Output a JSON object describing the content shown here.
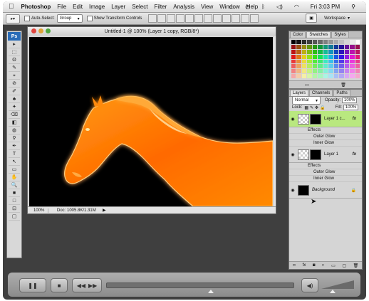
{
  "menubar": {
    "apple": "",
    "app_name": "Photoshop",
    "items": [
      "File",
      "Edit",
      "Image",
      "Layer",
      "Select",
      "Filter",
      "Analysis",
      "View",
      "Window",
      "Help"
    ],
    "clock": "Fri 3:03 PM"
  },
  "options_bar": {
    "auto_select_label": "Auto-Select:",
    "auto_select_value": "Group",
    "show_transform_label": "Show Transform Controls",
    "workspace_label": "Workspace"
  },
  "toolbox": {
    "logo": "Ps",
    "tools": [
      "▸",
      "⬚",
      "ʘ",
      "✎",
      "⌖",
      "⊘",
      "✐",
      "♣",
      "✦",
      "⌫",
      "◧",
      "◍",
      "⚲",
      "✒",
      "T",
      "↖",
      "▭",
      "✋",
      "🔍",
      "■",
      "□",
      "⊡",
      "▢"
    ]
  },
  "document": {
    "title": "Untitled-1 @ 100% (Layer 1 copy, RGB/8*)",
    "zoom": "100%",
    "doc_info": "Doc: 1005.8K/1.31M"
  },
  "swatches_panel": {
    "tabs": [
      "Color",
      "Swatches",
      "Styles"
    ],
    "active_tab": "Swatches"
  },
  "layers_panel": {
    "tabs": [
      "Layers",
      "Channels",
      "Paths"
    ],
    "active_tab": "Layers",
    "blend_mode": "Normal",
    "opacity_label": "Opacity:",
    "opacity_value": "100%",
    "lock_label": "Lock:",
    "fill_label": "Fill:",
    "fill_value": "100%",
    "layers": [
      {
        "name": "Layer 1 c...",
        "selected": true,
        "effects_label": "Effects",
        "effects": [
          "Outer Glow",
          "Inner Glow"
        ]
      },
      {
        "name": "Layer 1",
        "selected": false,
        "effects_label": "Effects",
        "effects": [
          "Outer Glow",
          "Inner Glow"
        ]
      },
      {
        "name": "Background",
        "selected": false,
        "locked": true
      }
    ],
    "fx_label": "fx"
  },
  "player": {
    "play_pause": "❚❚",
    "stop": "■",
    "rewind": "◀◀",
    "forward": "▶▶",
    "volume": "◀)"
  },
  "colors": {
    "selected_layer": "#b9e87f",
    "horse_glow": "#ff7a00"
  }
}
